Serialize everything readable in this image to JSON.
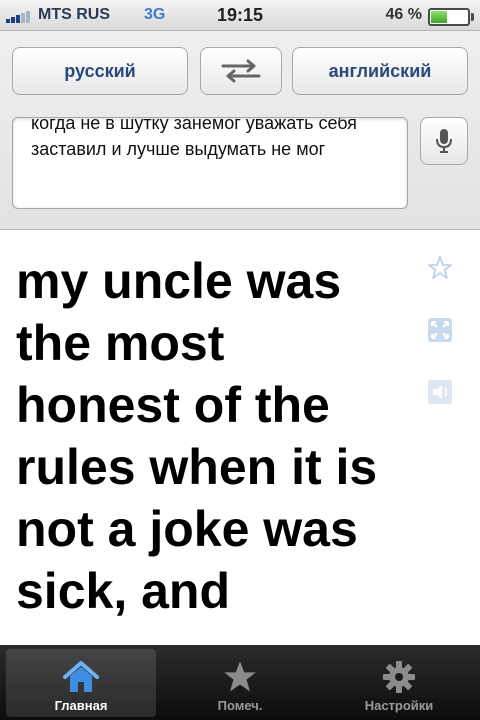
{
  "status_bar": {
    "carrier": "MTS RUS",
    "network": "3G",
    "time": "19:15",
    "battery_text": "46 %",
    "battery_level": 0.46
  },
  "languages": {
    "source": "русский",
    "target": "английский",
    "swap_icon": "swap-arrows-icon"
  },
  "input": {
    "text": "когда не в шутку занемог уважать себя заставил и лучше выдумать не мог",
    "mic_icon": "microphone-icon"
  },
  "translation": {
    "text": "my uncle was the most honest of the rules when it is not a joke was sick, and",
    "side_icons": [
      "star-icon",
      "fullscreen-icon",
      "speaker-icon"
    ]
  },
  "tabs": [
    {
      "label": "Главная",
      "icon": "home-icon",
      "active": true
    },
    {
      "label": "Помеч.",
      "icon": "star-icon",
      "active": false
    },
    {
      "label": "Настройки",
      "icon": "gear-icon",
      "active": false
    }
  ],
  "colors": {
    "accent": "#2a4a7c",
    "tab_active_icon": "#3f8ee6"
  }
}
